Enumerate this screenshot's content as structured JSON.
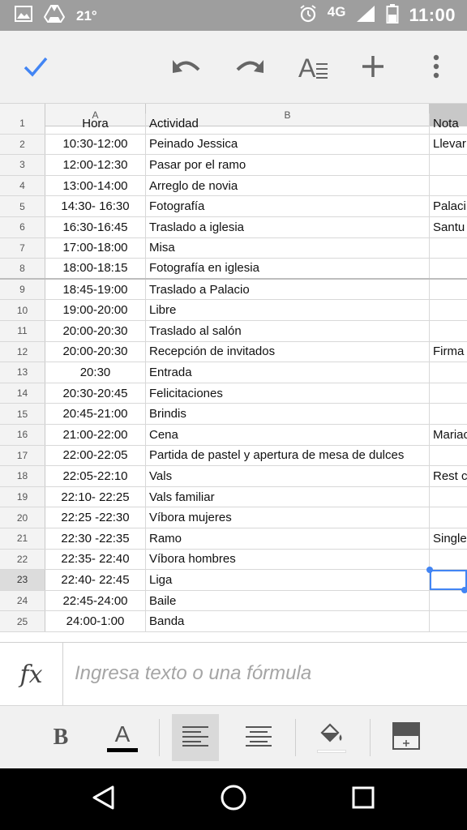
{
  "status_bar": {
    "temperature": "21°",
    "network": "4G",
    "time": "11:00",
    "icons": [
      "image-icon",
      "drive-icon",
      "alarm-icon",
      "signal-icon",
      "battery-icon"
    ]
  },
  "toolbar": {
    "icons": [
      "check-icon",
      "undo-icon",
      "redo-icon",
      "text-format-icon",
      "add-icon",
      "more-vert-icon"
    ],
    "accent": "#4285f4"
  },
  "sheet": {
    "columns": [
      "A",
      "B"
    ],
    "rows": [
      {
        "n": "1",
        "a": "Hora",
        "b": "Actividad",
        "c": "Nota"
      },
      {
        "n": "2",
        "a": "10:30-12:00",
        "b": "Peinado Jessica",
        "c": "Llevar"
      },
      {
        "n": "3",
        "a": "12:00-12:30",
        "b": "Pasar por el ramo",
        "c": ""
      },
      {
        "n": "4",
        "a": "13:00-14:00",
        "b": "Arreglo de novia",
        "c": ""
      },
      {
        "n": "5",
        "a": "14:30- 16:30",
        "b": "Fotografía",
        "c": "Palaci"
      },
      {
        "n": "6",
        "a": "16:30-16:45",
        "b": "Traslado a iglesia",
        "c": "Santu"
      },
      {
        "n": "7",
        "a": "17:00-18:00",
        "b": "Misa",
        "c": ""
      },
      {
        "n": "8",
        "a": "18:00-18:15",
        "b": "Fotografía en iglesia",
        "c": ""
      },
      {
        "n": "9",
        "a": "18:45-19:00",
        "b": "Traslado a Palacio",
        "c": ""
      },
      {
        "n": "10",
        "a": "19:00-20:00",
        "b": "Libre",
        "c": ""
      },
      {
        "n": "11",
        "a": "20:00-20:30",
        "b": "Traslado al salón",
        "c": ""
      },
      {
        "n": "12",
        "a": "20:00-20:30",
        "b": "Recepción de invitados",
        "c": "Firma"
      },
      {
        "n": "13",
        "a": "20:30",
        "b": "Entrada",
        "c": ""
      },
      {
        "n": "14",
        "a": "20:30-20:45",
        "b": "Felicitaciones",
        "c": ""
      },
      {
        "n": "15",
        "a": "20:45-21:00",
        "b": "Brindis",
        "c": ""
      },
      {
        "n": "16",
        "a": "21:00-22:00",
        "b": "Cena",
        "c": "Mariac"
      },
      {
        "n": "17",
        "a": "22:00-22:05",
        "b": "Partida de pastel y apertura de mesa de dulces",
        "c": ""
      },
      {
        "n": "18",
        "a": "22:05-22:10",
        "b": "Vals",
        "c": "Rest c"
      },
      {
        "n": "19",
        "a": "22:10- 22:25",
        "b": "Vals familiar",
        "c": ""
      },
      {
        "n": "20",
        "a": "22:25 -22:30",
        "b": "Víbora mujeres",
        "c": ""
      },
      {
        "n": "21",
        "a": "22:30 -22:35",
        "b": "Ramo",
        "c": "Single"
      },
      {
        "n": "22",
        "a": "22:35- 22:40",
        "b": "Víbora hombres",
        "c": ""
      },
      {
        "n": "23",
        "a": "22:40- 22:45",
        "b": "Liga",
        "c": ""
      },
      {
        "n": "24",
        "a": "22:45-24:00",
        "b": "Baile",
        "c": ""
      },
      {
        "n": "25",
        "a": "24:00-1:00",
        "b": "Banda",
        "c": ""
      }
    ],
    "selected_row": "23"
  },
  "formula_bar": {
    "label": "fx",
    "placeholder": "Ingresa texto o una fórmula"
  },
  "format_bar": {
    "icons": [
      "bold-icon",
      "text-color-icon",
      "align-left-icon",
      "align-center-icon",
      "fill-color-icon",
      "insert-row-icon"
    ],
    "bold_label": "B",
    "text_color_label": "A"
  },
  "nav_bar": {
    "icons": [
      "back-icon",
      "home-icon",
      "recents-icon"
    ]
  }
}
